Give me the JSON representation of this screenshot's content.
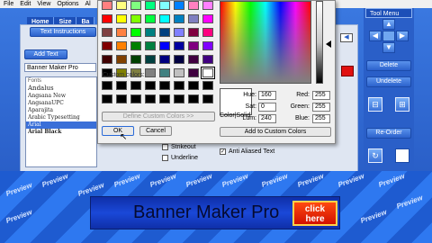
{
  "menu": [
    "File",
    "Edit",
    "View",
    "Options",
    "Al"
  ],
  "tabs": [
    "Home",
    "Size",
    "Ba"
  ],
  "left_panel": {
    "text_instructions": "Text Instructions",
    "add_text": "Add Text",
    "text_value": "Banner Maker Pro",
    "fonts_header": "Fonts",
    "fonts": [
      "Andalus",
      "Angsana New",
      "AngsanaUPC",
      "Aparajita",
      "Arabic Typesetting",
      "Arial",
      "Arial Black"
    ],
    "selected_font": "Arial",
    "checks": {
      "strikeout": "Strikeout",
      "underline": "Underline",
      "antialiased": "Anti Aliased Text",
      "antialiased_checked": "✓"
    }
  },
  "tool_menu": {
    "title": "Tool Menu",
    "delete": "Delete",
    "undelete": "Undelete",
    "reorder": "Re-Order"
  },
  "color_dialog": {
    "basic_colors": [
      "#ff8080",
      "#ffff80",
      "#80ff80",
      "#00ff80",
      "#80ffff",
      "#0080ff",
      "#ff80c0",
      "#ff80ff",
      "#ff0000",
      "#ffff00",
      "#80ff00",
      "#00ff40",
      "#00ffff",
      "#0080c0",
      "#8080c0",
      "#ff00ff",
      "#804040",
      "#ff8040",
      "#00ff00",
      "#008080",
      "#004080",
      "#8080ff",
      "#800040",
      "#ff0080",
      "#800000",
      "#ff8000",
      "#008000",
      "#008040",
      "#0000ff",
      "#0000a0",
      "#800080",
      "#8000ff",
      "#400000",
      "#804000",
      "#004000",
      "#004040",
      "#000080",
      "#000040",
      "#400040",
      "#400080",
      "#000000",
      "#808000",
      "#808040",
      "#808080",
      "#408080",
      "#c0c0c0",
      "#400040",
      "#ffffff"
    ],
    "custom_colors_label": "Custom colors:",
    "define_custom": "Define Custom Colors >>",
    "ok": "OK",
    "cancel": "Cancel",
    "color_solid": "Color|Solid",
    "hue_label": "Hue:",
    "hue": "160",
    "sat_label": "Sat:",
    "sat": "0",
    "lum_label": "Lum:",
    "lum": "240",
    "red_label": "Red:",
    "red": "255",
    "green_label": "Green:",
    "green": "255",
    "blue_label": "Blue:",
    "blue": "255",
    "add_custom": "Add to Custom Colors"
  },
  "preview": {
    "watermark": "Preview",
    "banner_text": "Banner Maker Pro",
    "click_here": "click here"
  }
}
